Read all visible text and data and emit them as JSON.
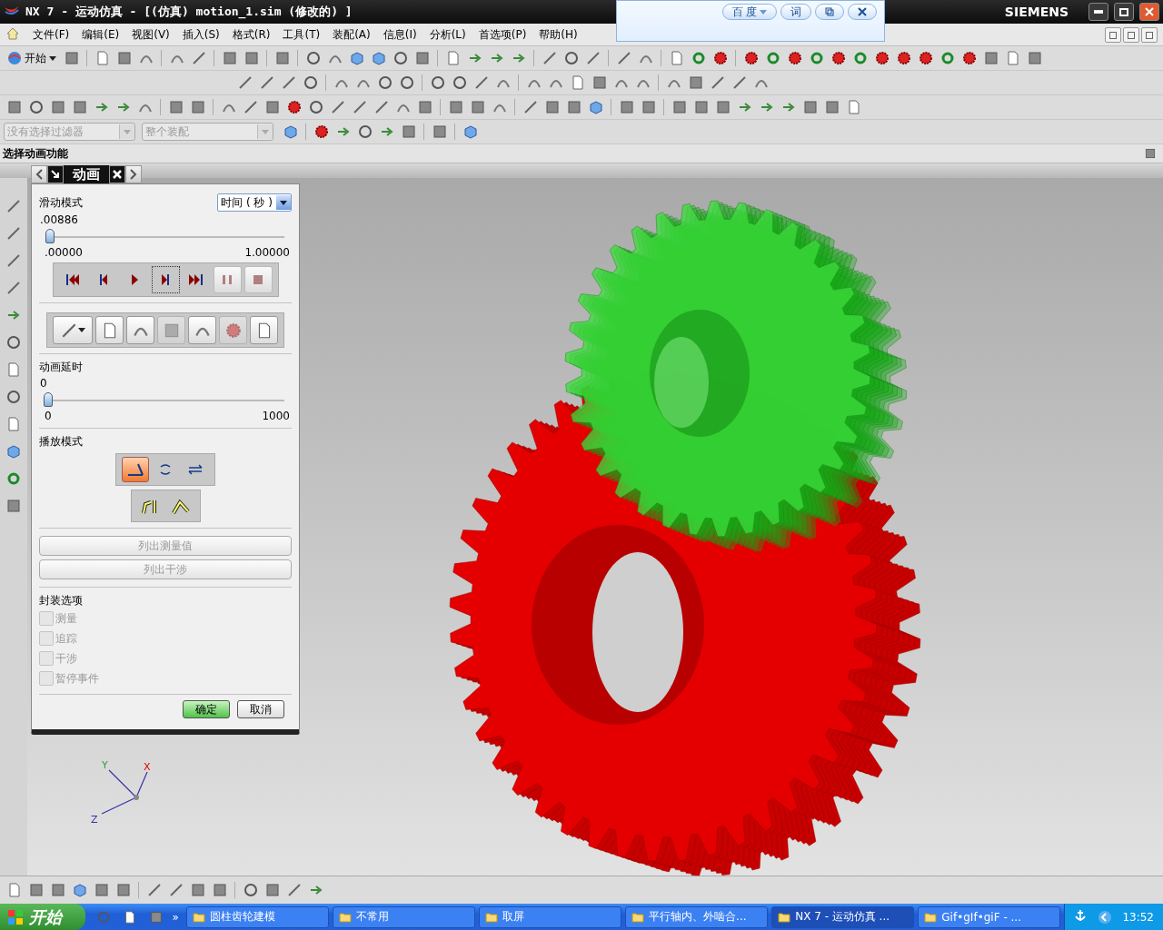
{
  "window": {
    "title": "NX 7 - 运动仿真 - [(仿真) motion_1.sim  (修改的) ]",
    "brand": "SIEMENS"
  },
  "translate_bar": {
    "search_button": "百 度",
    "word_button": "词"
  },
  "menu": [
    {
      "label": "文件(F)"
    },
    {
      "label": "编辑(E)"
    },
    {
      "label": "视图(V)"
    },
    {
      "label": "插入(S)"
    },
    {
      "label": "格式(R)"
    },
    {
      "label": "工具(T)"
    },
    {
      "label": "装配(A)"
    },
    {
      "label": "信息(I)"
    },
    {
      "label": "分析(L)"
    },
    {
      "label": "首选项(P)"
    },
    {
      "label": "帮助(H)"
    }
  ],
  "start_button": "开始",
  "filters": [
    {
      "value": "没有选择过滤器",
      "disabled": true
    },
    {
      "value": "整个装配",
      "disabled": true
    }
  ],
  "cue_line": "选择动画功能",
  "dialog": {
    "title": "动画",
    "slider_mode": {
      "label": "滑动模式",
      "value": "时间 ( 秒 )"
    },
    "time_slider": {
      "reading": ".00886",
      "level": 0.00886,
      "min": ".00000",
      "max": "1.00000"
    },
    "playback": [
      {
        "kind": "first",
        "disabled": false,
        "focused": false
      },
      {
        "kind": "prev",
        "disabled": false,
        "focused": false
      },
      {
        "kind": "play",
        "disabled": false,
        "focused": false
      },
      {
        "kind": "next",
        "disabled": false,
        "focused": true
      },
      {
        "kind": "last",
        "disabled": false,
        "focused": false
      },
      {
        "kind": "pause",
        "disabled": true,
        "focused": false
      },
      {
        "kind": "stop",
        "disabled": true,
        "focused": false
      }
    ],
    "tools": [
      {
        "disabled": false
      },
      {
        "disabled": false
      },
      {
        "disabled": false
      },
      {
        "disabled": true
      },
      {
        "disabled": false
      },
      {
        "disabled": true
      },
      {
        "disabled": false
      }
    ],
    "delay": {
      "label": "动画延时",
      "reading": "0",
      "level": 0,
      "min": "0",
      "max": "1000"
    },
    "play_mode": {
      "label": "播放模式",
      "modes": [
        {
          "kind": "once",
          "selected": true
        },
        {
          "kind": "loop",
          "selected": false
        },
        {
          "kind": "reverse",
          "selected": false
        }
      ]
    },
    "list_buttons": [
      {
        "label": "列出测量值",
        "disabled": true
      },
      {
        "label": "列出干涉",
        "disabled": true
      }
    ],
    "options": {
      "label": "封装选项",
      "items": [
        {
          "label": "测量",
          "checked": false,
          "disabled": true
        },
        {
          "label": "追踪",
          "checked": false,
          "disabled": true
        },
        {
          "label": "干涉",
          "checked": false,
          "disabled": true
        },
        {
          "label": "暂停事件",
          "checked": false,
          "disabled": true
        }
      ]
    },
    "ok": "确定",
    "cancel": "取消"
  },
  "triad": {
    "x": "X",
    "y": "Y",
    "z": "Z"
  },
  "taskbar": {
    "start": "开始",
    "more": "»",
    "tasks": [
      {
        "label": "圆柱齿轮建模",
        "selected": false
      },
      {
        "label": "不常用",
        "selected": false
      },
      {
        "label": "取屏",
        "selected": false
      },
      {
        "label": "平行轴内、外啮合...",
        "selected": false
      },
      {
        "label": "NX 7 - 运动仿真 ...",
        "selected": true
      },
      {
        "label": "Gif•gIf•giF - ...",
        "selected": false
      }
    ],
    "clock": "13:52"
  }
}
